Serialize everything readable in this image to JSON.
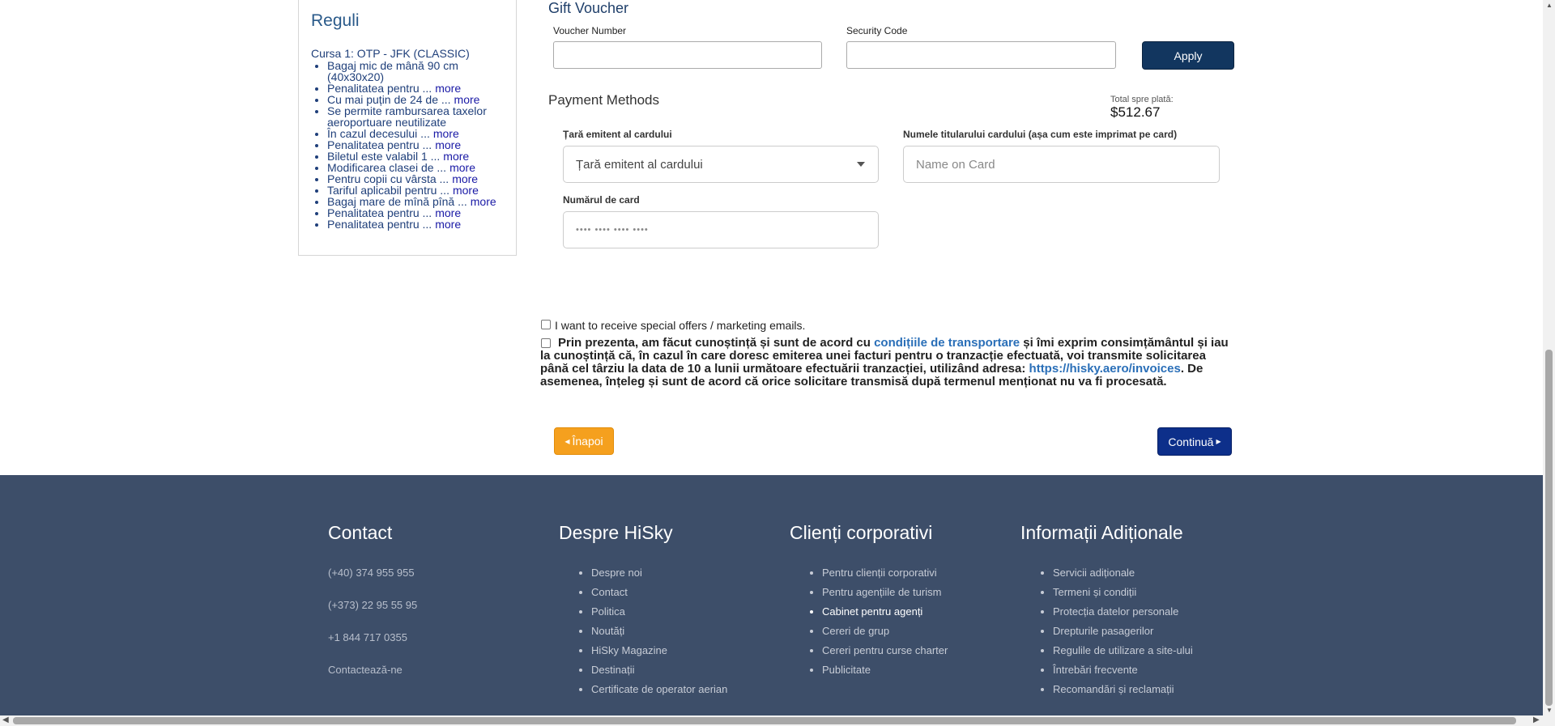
{
  "rules": {
    "title": "Reguli",
    "course": "Cursa 1: OTP - JFK (CLASSIC)",
    "items": [
      {
        "text": "Bagaj mic de mână 90 cm (40x30x20)",
        "more": ""
      },
      {
        "text": "Penalitatea pentru ...",
        "more": "more"
      },
      {
        "text": "Cu mai puțin de 24 de ...",
        "more": "more"
      },
      {
        "text": "Se permite rambursarea taxelor aeroportuare neutilizate",
        "more": ""
      },
      {
        "text": "În cazul decesului ...",
        "more": "more"
      },
      {
        "text": "Penalitatea pentru ...",
        "more": "more"
      },
      {
        "text": "Biletul este valabil 1 ...",
        "more": "more"
      },
      {
        "text": "Modificarea clasei de ...",
        "more": "more"
      },
      {
        "text": "Pentru copii cu vârsta ...",
        "more": "more"
      },
      {
        "text": "Tariful aplicabil pentru ...",
        "more": "more"
      },
      {
        "text": "Bagaj mare de mînă pînă ...",
        "more": "more"
      },
      {
        "text": "Penalitatea pentru ...",
        "more": "more"
      },
      {
        "text": "Penalitatea pentru ...",
        "more": "more"
      }
    ]
  },
  "voucher": {
    "title": "Gift Voucher",
    "number_label": "Voucher Number",
    "security_label": "Security Code",
    "apply_label": "Apply"
  },
  "payment": {
    "title": "Payment Methods",
    "total_label": "Total spre plată:",
    "total_value": "$512.67",
    "country_label": "Țară emitent al cardului",
    "country_value": "Țară emitent al cardului",
    "holder_label": "Numele titularului cardului (așa cum este imprimat pe card)",
    "holder_placeholder": "Name on Card",
    "card_label": "Numărul de card",
    "card_placeholder": "•••• •••• •••• ••••"
  },
  "consent": {
    "offers_text": "I want to receive special offers / marketing emails.",
    "terms_1": "Prin prezenta, am făcut cunoștință și sunt de acord cu ",
    "terms_link": "condițiile de transportare",
    "terms_2": " și îmi exprim consimțământul și iau la cunoștință că, în cazul în care doresc emiterea unei facturi pentru o tranzacție efectuată, voi transmite solicitarea până cel târziu la data de 10 a lunii următoare efectuării tranzacției, utilizând adresa: ",
    "invoice_link": "https://hisky.aero/invoices",
    "terms_3": ". De asemenea, înțeleg și sunt de acord că orice solicitare transmisă după termenul menționat nu va fi procesată."
  },
  "nav": {
    "back_label": "Înapoi",
    "next_label": "Continuă"
  },
  "footer": {
    "contact": {
      "title": "Contact",
      "lines": [
        "(+40) 374 955 955",
        "(+373) 22 95 55 95",
        "+1 844 717 0355",
        "Contactează-ne"
      ]
    },
    "about": {
      "title": "Despre HiSky",
      "items": [
        "Despre noi",
        "Contact",
        "Politica",
        "Noutăți",
        "HiSky Magazine",
        "Destinații",
        "Certificate de operator aerian"
      ]
    },
    "corporate": {
      "title": "Clienți corporativi",
      "items": [
        "Pentru clienții corporativi",
        "Pentru agențiile de turism",
        "Cabinet pentru agenți",
        "Cereri de grup",
        "Cereri pentru curse charter",
        "Publicitate"
      ]
    },
    "info": {
      "title": "Informații Adiționale",
      "items": [
        "Servicii adiționale",
        "Termeni și condiții",
        "Protecția datelor personale",
        "Drepturile pasagerilor",
        "Regulile de utilizare a site-ului",
        "Întrebări frecvente",
        "Recomandări și reclamații"
      ]
    }
  }
}
